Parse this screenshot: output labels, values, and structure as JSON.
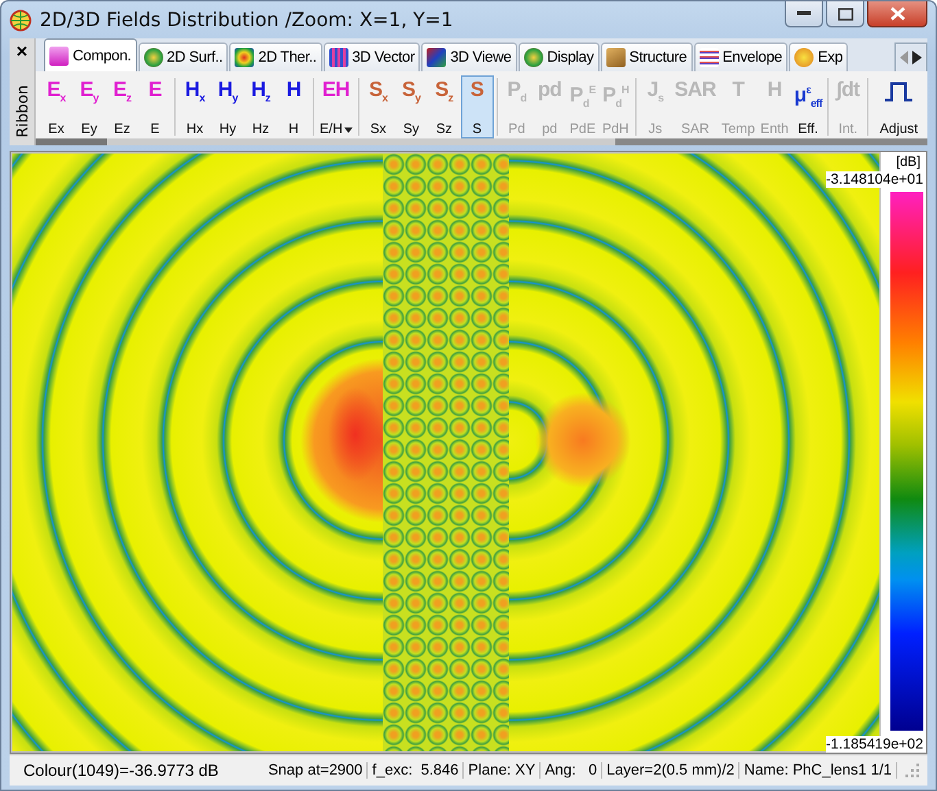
{
  "window": {
    "title": "2D/3D Fields Distribution /Zoom: X=1, Y=1"
  },
  "tabs": [
    {
      "label": "Compon.",
      "kind": "e",
      "selected": true
    },
    {
      "label": "2D Surf..",
      "kind": "globe",
      "selected": false
    },
    {
      "label": "2D Ther..",
      "kind": "thermal",
      "selected": false
    },
    {
      "label": "3D Vector",
      "kind": "vector",
      "selected": false
    },
    {
      "label": "3D Viewe",
      "kind": "viewer",
      "selected": false
    },
    {
      "label": "Display",
      "kind": "globe",
      "selected": false
    },
    {
      "label": "Structure",
      "kind": "block",
      "selected": false
    },
    {
      "label": "Envelope",
      "kind": "wave",
      "selected": false
    },
    {
      "label": "Exp",
      "kind": "star",
      "selected": false
    }
  ],
  "ribbon": {
    "label": "Ribbon",
    "close": "×",
    "groups": [
      {
        "kind": "e",
        "buttons": [
          {
            "glyph": "E$_{x}$",
            "label": "Ex",
            "disabled": false,
            "selected": false
          },
          {
            "glyph": "E$_{y}$",
            "label": "Ey",
            "disabled": false,
            "selected": false
          },
          {
            "glyph": "E$_{z}$",
            "label": "Ez",
            "disabled": false,
            "selected": false
          },
          {
            "glyph": "E",
            "label": "E",
            "disabled": false,
            "selected": false
          }
        ]
      },
      {
        "kind": "h",
        "buttons": [
          {
            "glyph": "H$_{x}$",
            "label": "Hx",
            "disabled": false,
            "selected": false
          },
          {
            "glyph": "H$_{y}$",
            "label": "Hy",
            "disabled": false,
            "selected": false
          },
          {
            "glyph": "H$_{z}$",
            "label": "Hz",
            "disabled": false,
            "selected": false
          },
          {
            "glyph": "H",
            "label": "H",
            "disabled": false,
            "selected": false
          }
        ]
      },
      {
        "kind": "e",
        "buttons": [
          {
            "glyph": "EH",
            "label": "E/H",
            "disabled": false,
            "selected": false,
            "dropdown": true
          }
        ]
      },
      {
        "kind": "s",
        "buttons": [
          {
            "glyph": "S$_{x}$",
            "label": "Sx",
            "disabled": false,
            "selected": false
          },
          {
            "glyph": "S$_{y}$",
            "label": "Sy",
            "disabled": false,
            "selected": false
          },
          {
            "glyph": "S$_{z}$",
            "label": "Sz",
            "disabled": false,
            "selected": false
          },
          {
            "glyph": "S",
            "label": "S",
            "disabled": false,
            "selected": true
          }
        ]
      },
      {
        "kind": "s",
        "buttons": [
          {
            "glyph": "P$_{d}$",
            "label": "Pd",
            "disabled": true,
            "selected": false
          },
          {
            "glyph": "pd",
            "label": "pd",
            "disabled": true,
            "selected": false
          },
          {
            "glyph": "P$_{d}$$^{E}$",
            "label": "PdE",
            "disabled": true,
            "selected": false
          },
          {
            "glyph": "P$_{d}$$^{H}$",
            "label": "PdH",
            "disabled": true,
            "selected": false
          }
        ]
      },
      {
        "kind": "j",
        "buttons": [
          {
            "glyph": "J$_{s}$",
            "label": "Js",
            "disabled": true,
            "selected": false
          },
          {
            "glyph": "SAR",
            "label": "SAR",
            "disabled": true,
            "selected": false
          },
          {
            "glyph": "T",
            "label": "Temp",
            "disabled": true,
            "selected": false
          },
          {
            "glyph": "H",
            "label": "Enth",
            "disabled": true,
            "selected": false
          },
          {
            "glyph": "μ$^{ε}$$_{eff}$",
            "label": "Eff.",
            "disabled": false,
            "selected": false
          }
        ]
      },
      {
        "kind": "j",
        "buttons": [
          {
            "glyph": "∫dt",
            "label": "Int.",
            "disabled": true,
            "selected": false
          }
        ]
      },
      {
        "kind": "adjust",
        "buttons": [
          {
            "label": "Adjust",
            "disabled": false,
            "selected": false
          }
        ]
      }
    ]
  },
  "colorbar": {
    "unit": "[dB]",
    "max": "-3.148104e+01",
    "min": "-1.185419e+02"
  },
  "status_bar": [
    "Colour(1049)=-36.9773 dB",
    "Snap at=2900",
    "f_exc:  5.846",
    "Plane: XY",
    "Ang:   0",
    "Layer=2(0.5 mm)/2",
    "Name: PhC_lens1 1/1"
  ]
}
